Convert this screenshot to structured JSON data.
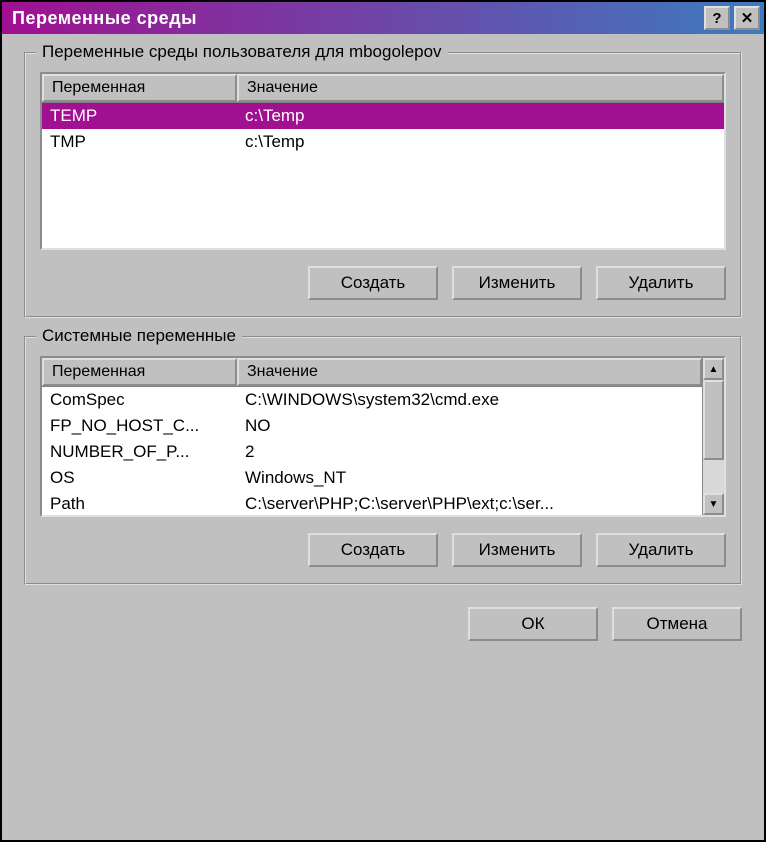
{
  "title": "Переменные среды",
  "titlebar": {
    "help_label": "?",
    "close_label": "✕"
  },
  "user_group": {
    "legend": "Переменные среды пользователя для mbogolepov",
    "columns": {
      "variable": "Переменная",
      "value": "Значение"
    },
    "rows": [
      {
        "name": "TEMP",
        "value": "c:\\Temp",
        "selected": true
      },
      {
        "name": "TMP",
        "value": "c:\\Temp",
        "selected": false
      }
    ],
    "buttons": {
      "create": "Создать",
      "edit": "Изменить",
      "delete": "Удалить"
    }
  },
  "system_group": {
    "legend": "Системные переменные",
    "columns": {
      "variable": "Переменная",
      "value": "Значение"
    },
    "rows": [
      {
        "name": "ComSpec",
        "value": "C:\\WINDOWS\\system32\\cmd.exe"
      },
      {
        "name": "FP_NO_HOST_C...",
        "value": "NO"
      },
      {
        "name": "NUMBER_OF_P...",
        "value": "2"
      },
      {
        "name": "OS",
        "value": "Windows_NT"
      },
      {
        "name": "Path",
        "value": "C:\\server\\PHP;C:\\server\\PHP\\ext;c:\\ser..."
      }
    ],
    "buttons": {
      "create": "Создать",
      "edit": "Изменить",
      "delete": "Удалить"
    }
  },
  "dialog_buttons": {
    "ok": "ОК",
    "cancel": "Отмена"
  }
}
